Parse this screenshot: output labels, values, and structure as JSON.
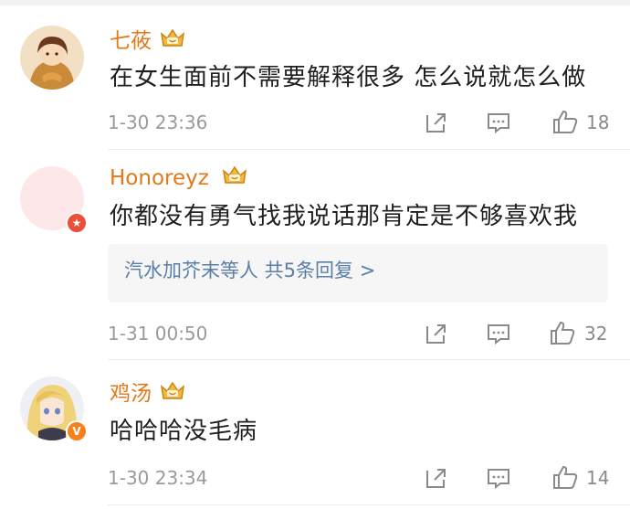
{
  "comments": [
    {
      "username": "七莜",
      "text": "在女生面前不需要解释很多 怎么说就怎么做",
      "time": "1-30 23:36",
      "likes": "18",
      "badge_icon": "",
      "avatar_icon": "girl-cartoon-avatar-icon"
    },
    {
      "username": "Honoreyz",
      "text": "你都没有勇气找我说话那肯定是不够喜欢我",
      "time": "1-31 00:50",
      "likes": "32",
      "reply_summary": "汽水加芥末等人 共5条回复 >",
      "badge_icon": "star-badge-icon",
      "avatar_icon": "pink-blank-avatar-icon"
    },
    {
      "username": "鸡汤",
      "text": "哈哈哈没毛病",
      "time": "1-30 23:34",
      "likes": "14",
      "badge_icon": "verified-v-badge-icon",
      "avatar_icon": "anime-blonde-avatar-icon"
    }
  ],
  "colors": {
    "username": "#e07a1a",
    "reply_link": "#5a7fa8",
    "meta": "#9a9a9a",
    "badge_red": "#e8503a",
    "badge_orange": "#f5821f"
  }
}
